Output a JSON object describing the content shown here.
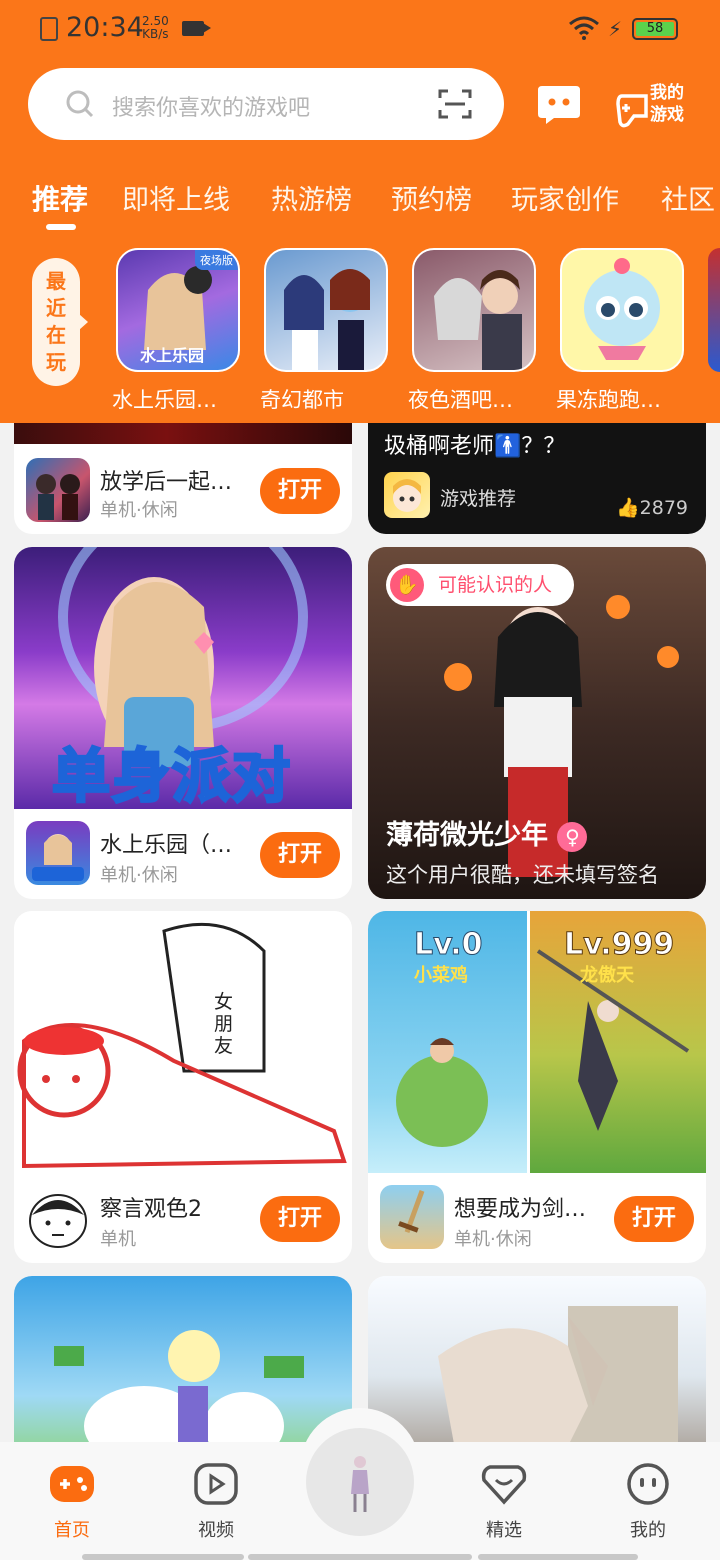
{
  "status_bar": {
    "time": "20:34",
    "speed_value": "2.50",
    "speed_unit": "KB/s",
    "battery": "58"
  },
  "search": {
    "placeholder": "搜索你喜欢的游戏吧"
  },
  "header": {
    "my_games_label_1": "我的",
    "my_games_label_2": "游戏"
  },
  "tabs": [
    {
      "label": "推荐",
      "active": true
    },
    {
      "label": "即将上线"
    },
    {
      "label": "热游榜"
    },
    {
      "label": "预约榜"
    },
    {
      "label": "玩家创作"
    },
    {
      "label": "社区"
    }
  ],
  "recent": {
    "badge_chars": [
      "最",
      "近",
      "在",
      "玩"
    ],
    "games": [
      {
        "name": "水上乐园…",
        "icon_text": "水上乐园",
        "tag": "夜场版"
      },
      {
        "name": "奇幻都市"
      },
      {
        "name": "夜色酒吧…"
      },
      {
        "name": "果冻跑跑…"
      }
    ]
  },
  "feed": {
    "card1": {
      "title": "放学后一起…",
      "sub": "单机·休闲",
      "button": "打开"
    },
    "post1": {
      "text": "圾桶啊老师🚹？？",
      "author": "游戏推荐",
      "likes": "2879"
    },
    "card2": {
      "banner_text": "单身派对",
      "title": "水上乐园（…",
      "sub": "单机·休闲",
      "button": "打开"
    },
    "person_card": {
      "chip": "可能认识的人",
      "name": "薄荷微光少年",
      "gender": "♀",
      "signature": "这个用户很酷，还未填写签名"
    },
    "card3": {
      "title": "察言观色2",
      "sub": "单机",
      "button": "打开",
      "img_text": "女朋友"
    },
    "card4": {
      "lv_left": "Lv.0",
      "lv_left_name": "小菜鸡",
      "lv_right": "Lv.999",
      "lv_right_name": "龙傲天",
      "title": "想要成为剑…",
      "sub": "单机·休闲",
      "button": "打开"
    }
  },
  "nav": [
    {
      "label": "首页",
      "active": true
    },
    {
      "label": "视频"
    },
    {
      "label": "精选"
    },
    {
      "label": "我的"
    }
  ],
  "colors": {
    "brand": "#fb7619",
    "button": "#fb6c10"
  }
}
